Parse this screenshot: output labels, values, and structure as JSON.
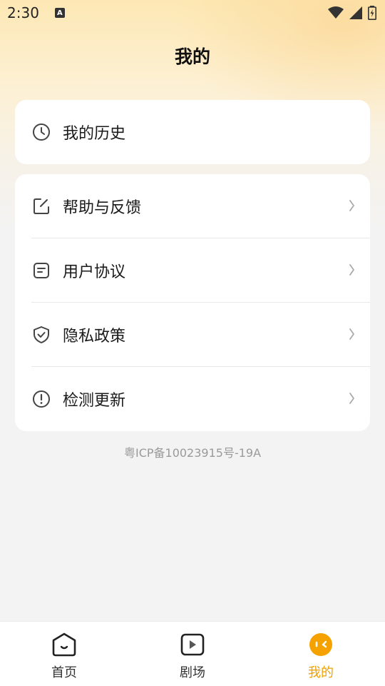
{
  "status_bar": {
    "time": "2:30",
    "notification_letter": "A"
  },
  "header": {
    "title": "我的"
  },
  "history": {
    "label": "我的历史",
    "icon": "clock-icon"
  },
  "menu": [
    {
      "label": "帮助与反馈",
      "icon": "edit-icon"
    },
    {
      "label": "用户协议",
      "icon": "document-icon"
    },
    {
      "label": "隐私政策",
      "icon": "shield-icon"
    },
    {
      "label": "检测更新",
      "icon": "alert-circle-icon"
    }
  ],
  "footer": {
    "icp": "粤ICP备10023915号-19A"
  },
  "bottom_nav": {
    "items": [
      {
        "label": "首页",
        "icon": "home-icon",
        "active": false
      },
      {
        "label": "剧场",
        "icon": "play-icon",
        "active": false
      },
      {
        "label": "我的",
        "icon": "profile-face-icon",
        "active": true
      }
    ]
  },
  "colors": {
    "accent": "#f0a000",
    "text": "#1a1a1a",
    "muted": "#9a9a9a"
  }
}
